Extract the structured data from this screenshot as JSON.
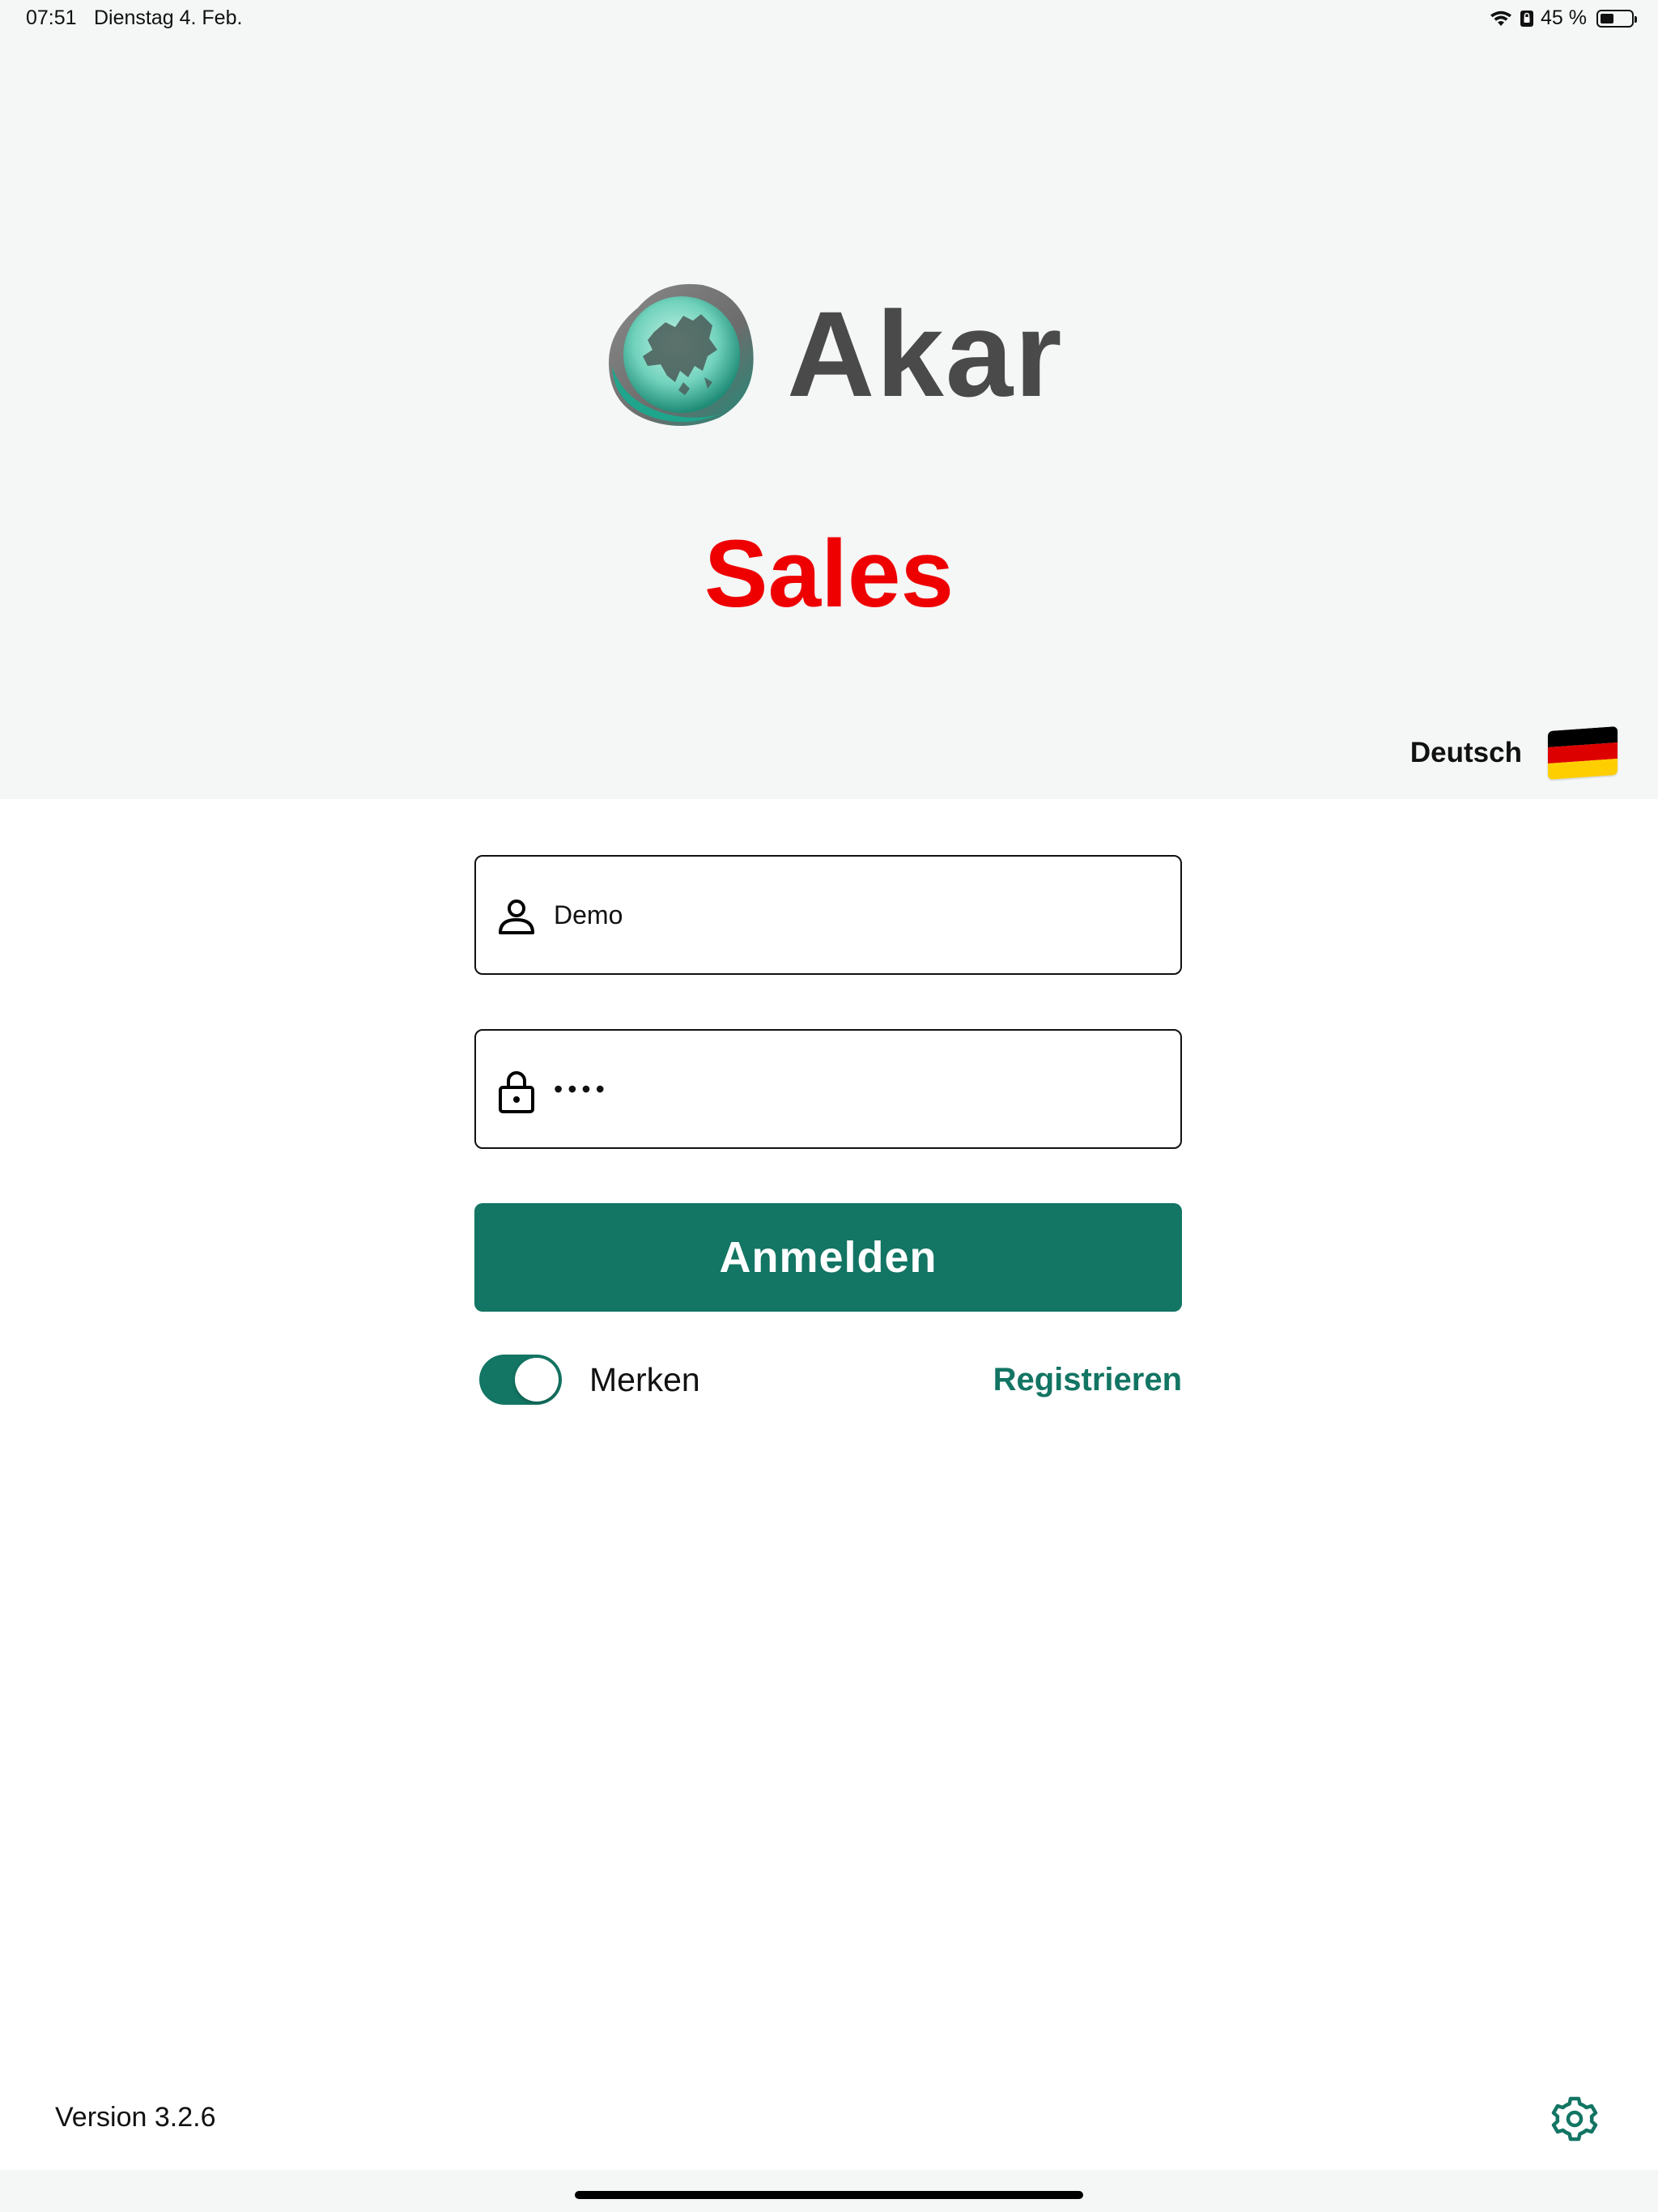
{
  "status_bar": {
    "time": "07:51",
    "date": "Dienstag 4. Feb.",
    "battery_percent_label": "45 %",
    "battery_level": 0.45
  },
  "header": {
    "logo_text": "Akar",
    "app_title": "Sales",
    "app_title_color": "#ee0000",
    "language": {
      "label": "Deutsch",
      "flag_icon": "germany-flag-icon",
      "flag_colors": [
        "#000000",
        "#dd0000",
        "#ffce00"
      ]
    }
  },
  "login_form": {
    "username": {
      "value": "Demo",
      "icon": "person-icon"
    },
    "password": {
      "value": "••••",
      "icon": "lock-icon"
    },
    "submit_label": "Anmelden",
    "remember": {
      "label": "Merken",
      "checked": true
    },
    "register_label": "Registrieren"
  },
  "footer": {
    "version": "Version 3.2.6",
    "settings_icon": "gear-icon"
  },
  "colors": {
    "accent": "#137563",
    "header_background": "#f4f7f6",
    "background": "#ffffff"
  }
}
